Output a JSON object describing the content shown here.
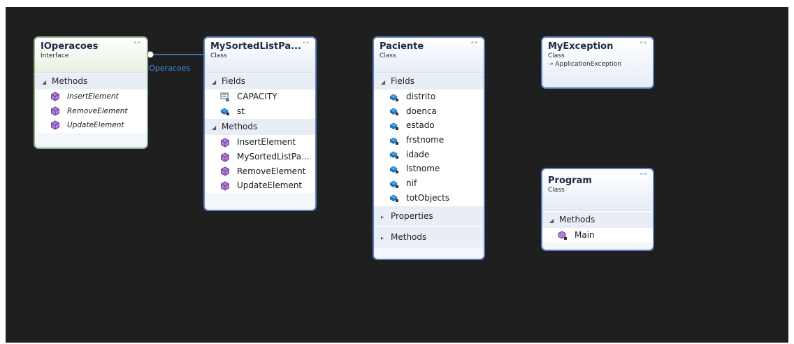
{
  "interface_label": "IOperacoes",
  "boxes": [
    {
      "name": "IOperacoes",
      "kind": "Interface",
      "sections": [
        {
          "label": "Methods",
          "members": [
            "InsertElement",
            "RemoveElement",
            "UpdateElement"
          ]
        }
      ]
    },
    {
      "name": "MySortedListPa...",
      "kind": "Class",
      "sections": [
        {
          "label": "Fields",
          "members": [
            "CAPACITY",
            "st"
          ]
        },
        {
          "label": "Methods",
          "members": [
            "InsertElement",
            "MySortedListPa...",
            "RemoveElement",
            "UpdateElement"
          ]
        }
      ]
    },
    {
      "name": "Paciente",
      "kind": "Class",
      "sections": [
        {
          "label": "Fields",
          "members": [
            "distrito",
            "doenca",
            "estado",
            "frstnome",
            "idade",
            "lstnome",
            "nif",
            "totObjects"
          ]
        },
        {
          "label": "Properties"
        },
        {
          "label": "Methods"
        }
      ]
    },
    {
      "name": "MyException",
      "kind": "Class",
      "base": "ApplicationException"
    },
    {
      "name": "Program",
      "kind": "Class",
      "sections": [
        {
          "label": "Methods",
          "members": [
            "Main"
          ]
        }
      ]
    }
  ],
  "colors": {
    "canvas": "#1f1f1f",
    "border": "#5b7fbd",
    "method_icon": "#8b4fb5",
    "field_icon": "#2e7fc2",
    "connector": "#3a8ee6"
  },
  "icons": {
    "expanded": "chevron-up-icon",
    "collapsed": "chevron-down-icon",
    "method": "method-cube-icon",
    "private_field": "private-field-icon",
    "constant": "constant-icon"
  }
}
